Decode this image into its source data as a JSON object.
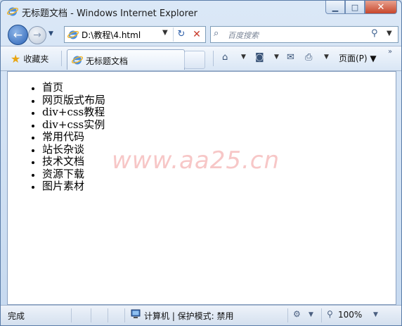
{
  "window": {
    "title": "无标题文档 - Windows Internet Explorer"
  },
  "nav": {
    "address": "D:\\教程\\4.html",
    "search_placeholder": "百度搜索"
  },
  "command_bar": {
    "favorites_label": "收藏夹",
    "tab_label": "无标题文档",
    "page_menu_label": "页面(P)"
  },
  "content": {
    "list_items": [
      "首页",
      "网页版式布局",
      "div+css教程",
      "div+css实例",
      "常用代码",
      "站长杂谈",
      "技术文档",
      "资源下载",
      "图片素材"
    ],
    "watermark": "www.aa25.cn"
  },
  "status": {
    "done_text": "完成",
    "zone_text": "计算机 | 保护模式: 禁用",
    "zoom_text": "100%"
  },
  "icons": [
    "ie-logo-icon",
    "back-arrow-icon",
    "forward-arrow-icon",
    "refresh-icon",
    "stop-icon",
    "search-icon",
    "favorites-star-icon",
    "home-icon",
    "rss-icon",
    "mail-icon",
    "print-icon",
    "computer-icon",
    "zoom-icon"
  ]
}
